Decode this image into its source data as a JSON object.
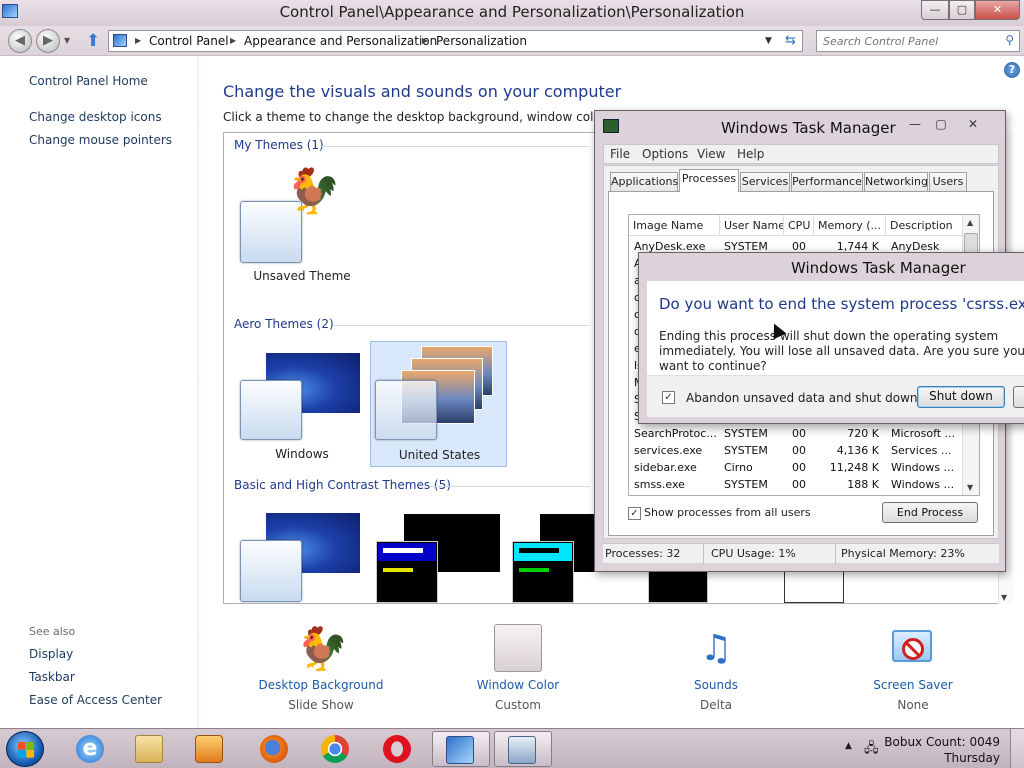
{
  "window": {
    "title": "Control Panel\\Appearance and Personalization\\Personalization",
    "controls": {
      "minimize": "—",
      "maximize": "▢",
      "close": "✕"
    }
  },
  "address": {
    "crumbs": [
      "Control Panel",
      "Appearance and Personalization",
      "Personalization"
    ],
    "search_placeholder": "Search Control Panel"
  },
  "left_nav": {
    "links": [
      "Control Panel Home",
      "Change desktop icons",
      "Change mouse pointers"
    ],
    "see_also_heading": "See also",
    "see_also": [
      "Display",
      "Taskbar",
      "Ease of Access Center"
    ]
  },
  "main": {
    "heading": "Change the visuals and sounds on your computer",
    "subheading": "Click a theme to change the desktop background, window color, soun",
    "groups": {
      "my_themes": "My Themes (1)",
      "aero_themes": "Aero Themes (2)",
      "basic_themes": "Basic and High Contrast Themes (5)"
    },
    "themes": {
      "unsaved": "Unsaved Theme",
      "windows": "Windows",
      "united_states": "United States"
    }
  },
  "customize": [
    {
      "title": "Desktop Background",
      "value": "Slide Show"
    },
    {
      "title": "Window Color",
      "value": "Custom"
    },
    {
      "title": "Sounds",
      "value": "Delta"
    },
    {
      "title": "Screen Saver",
      "value": "None"
    }
  ],
  "task_manager": {
    "title": "Windows Task Manager",
    "menu": [
      "File",
      "Options",
      "View",
      "Help"
    ],
    "tabs": [
      "Applications",
      "Processes",
      "Services",
      "Performance",
      "Networking",
      "Users"
    ],
    "active_tab": "Processes",
    "columns": [
      "Image Name",
      "User Name",
      "CPU",
      "Memory (...",
      "Description"
    ],
    "rows": [
      {
        "name": "AnyDesk.exe",
        "user": "SYSTEM",
        "cpu": "00",
        "mem": "1,744 K",
        "desc": "AnyDesk"
      },
      {
        "name": "A",
        "user": "",
        "cpu": "",
        "mem": "",
        "desc": ""
      },
      {
        "name": "a",
        "user": "",
        "cpu": "",
        "mem": "",
        "desc": ""
      },
      {
        "name": "cs",
        "user": "",
        "cpu": "",
        "mem": "",
        "desc": ""
      },
      {
        "name": "c",
        "user": "",
        "cpu": "",
        "mem": "",
        "desc": ""
      },
      {
        "name": "d",
        "user": "",
        "cpu": "",
        "mem": "",
        "desc": ""
      },
      {
        "name": "e",
        "user": "",
        "cpu": "",
        "mem": "",
        "desc": ""
      },
      {
        "name": "ls",
        "user": "",
        "cpu": "",
        "mem": "",
        "desc": ""
      },
      {
        "name": "M",
        "user": "",
        "cpu": "",
        "mem": "",
        "desc": ""
      },
      {
        "name": "S",
        "user": "",
        "cpu": "",
        "mem": "",
        "desc": ""
      },
      {
        "name": "S",
        "user": "",
        "cpu": "",
        "mem": "",
        "desc": ""
      },
      {
        "name": "SearchProtoc...",
        "user": "SYSTEM",
        "cpu": "00",
        "mem": "720 K",
        "desc": "Microsoft ..."
      },
      {
        "name": "services.exe",
        "user": "SYSTEM",
        "cpu": "00",
        "mem": "4,136 K",
        "desc": "Services ..."
      },
      {
        "name": "sidebar.exe",
        "user": "Cirno",
        "cpu": "00",
        "mem": "11,248 K",
        "desc": "Windows ..."
      },
      {
        "name": "smss.exe",
        "user": "SYSTEM",
        "cpu": "00",
        "mem": "188 K",
        "desc": "Windows ..."
      }
    ],
    "show_all_label": "Show processes from all users",
    "end_process_label": "End Process",
    "status": {
      "processes": "Processes: 32",
      "cpu": "CPU Usage: 1%",
      "memory": "Physical Memory: 23%"
    }
  },
  "dialog": {
    "title": "Windows Task Manager",
    "question": "Do you want to end the system process 'csrss.exe'?",
    "message": "Ending this process will shut down the operating system immediately. You will lose all unsaved data.  Are you sure you want to continue?",
    "checkbox_label": "Abandon unsaved data and shut down.",
    "shutdown_label": "Shut down"
  },
  "taskbar": {
    "clock_line1": "Bobux Count: 0049",
    "clock_line2": "Thursday"
  }
}
